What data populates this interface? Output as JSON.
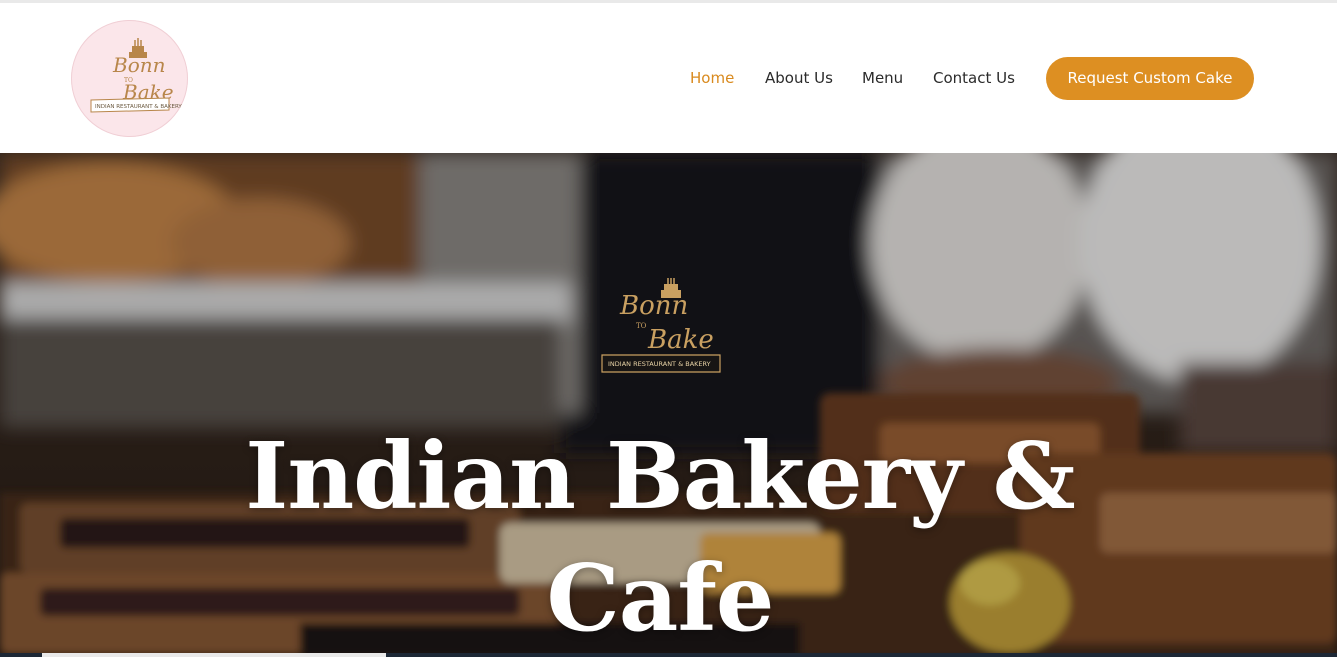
{
  "brand": {
    "logo_text_line1": "Bonn",
    "logo_text_line2": "TO",
    "logo_text_line3": "Bake",
    "logo_ribbon": "INDIAN RESTAURANT & BAKERY",
    "badge_color": "#fbe6ea",
    "gold_color": "#b8864a"
  },
  "nav": {
    "items": [
      {
        "label": "Home",
        "active": true
      },
      {
        "label": "About Us",
        "active": false
      },
      {
        "label": "Menu",
        "active": false
      },
      {
        "label": "Contact Us",
        "active": false
      }
    ],
    "active_color": "#d98a1e",
    "text_color": "#2b2b2b"
  },
  "cta": {
    "label": "Request Custom Cake",
    "color": "#dd8f22"
  },
  "hero": {
    "title_line1": "Indian Bakery &",
    "title_line2": "Cafe",
    "background_icon": "bakery-display-photo"
  },
  "slider": {
    "progress": 0.26
  }
}
